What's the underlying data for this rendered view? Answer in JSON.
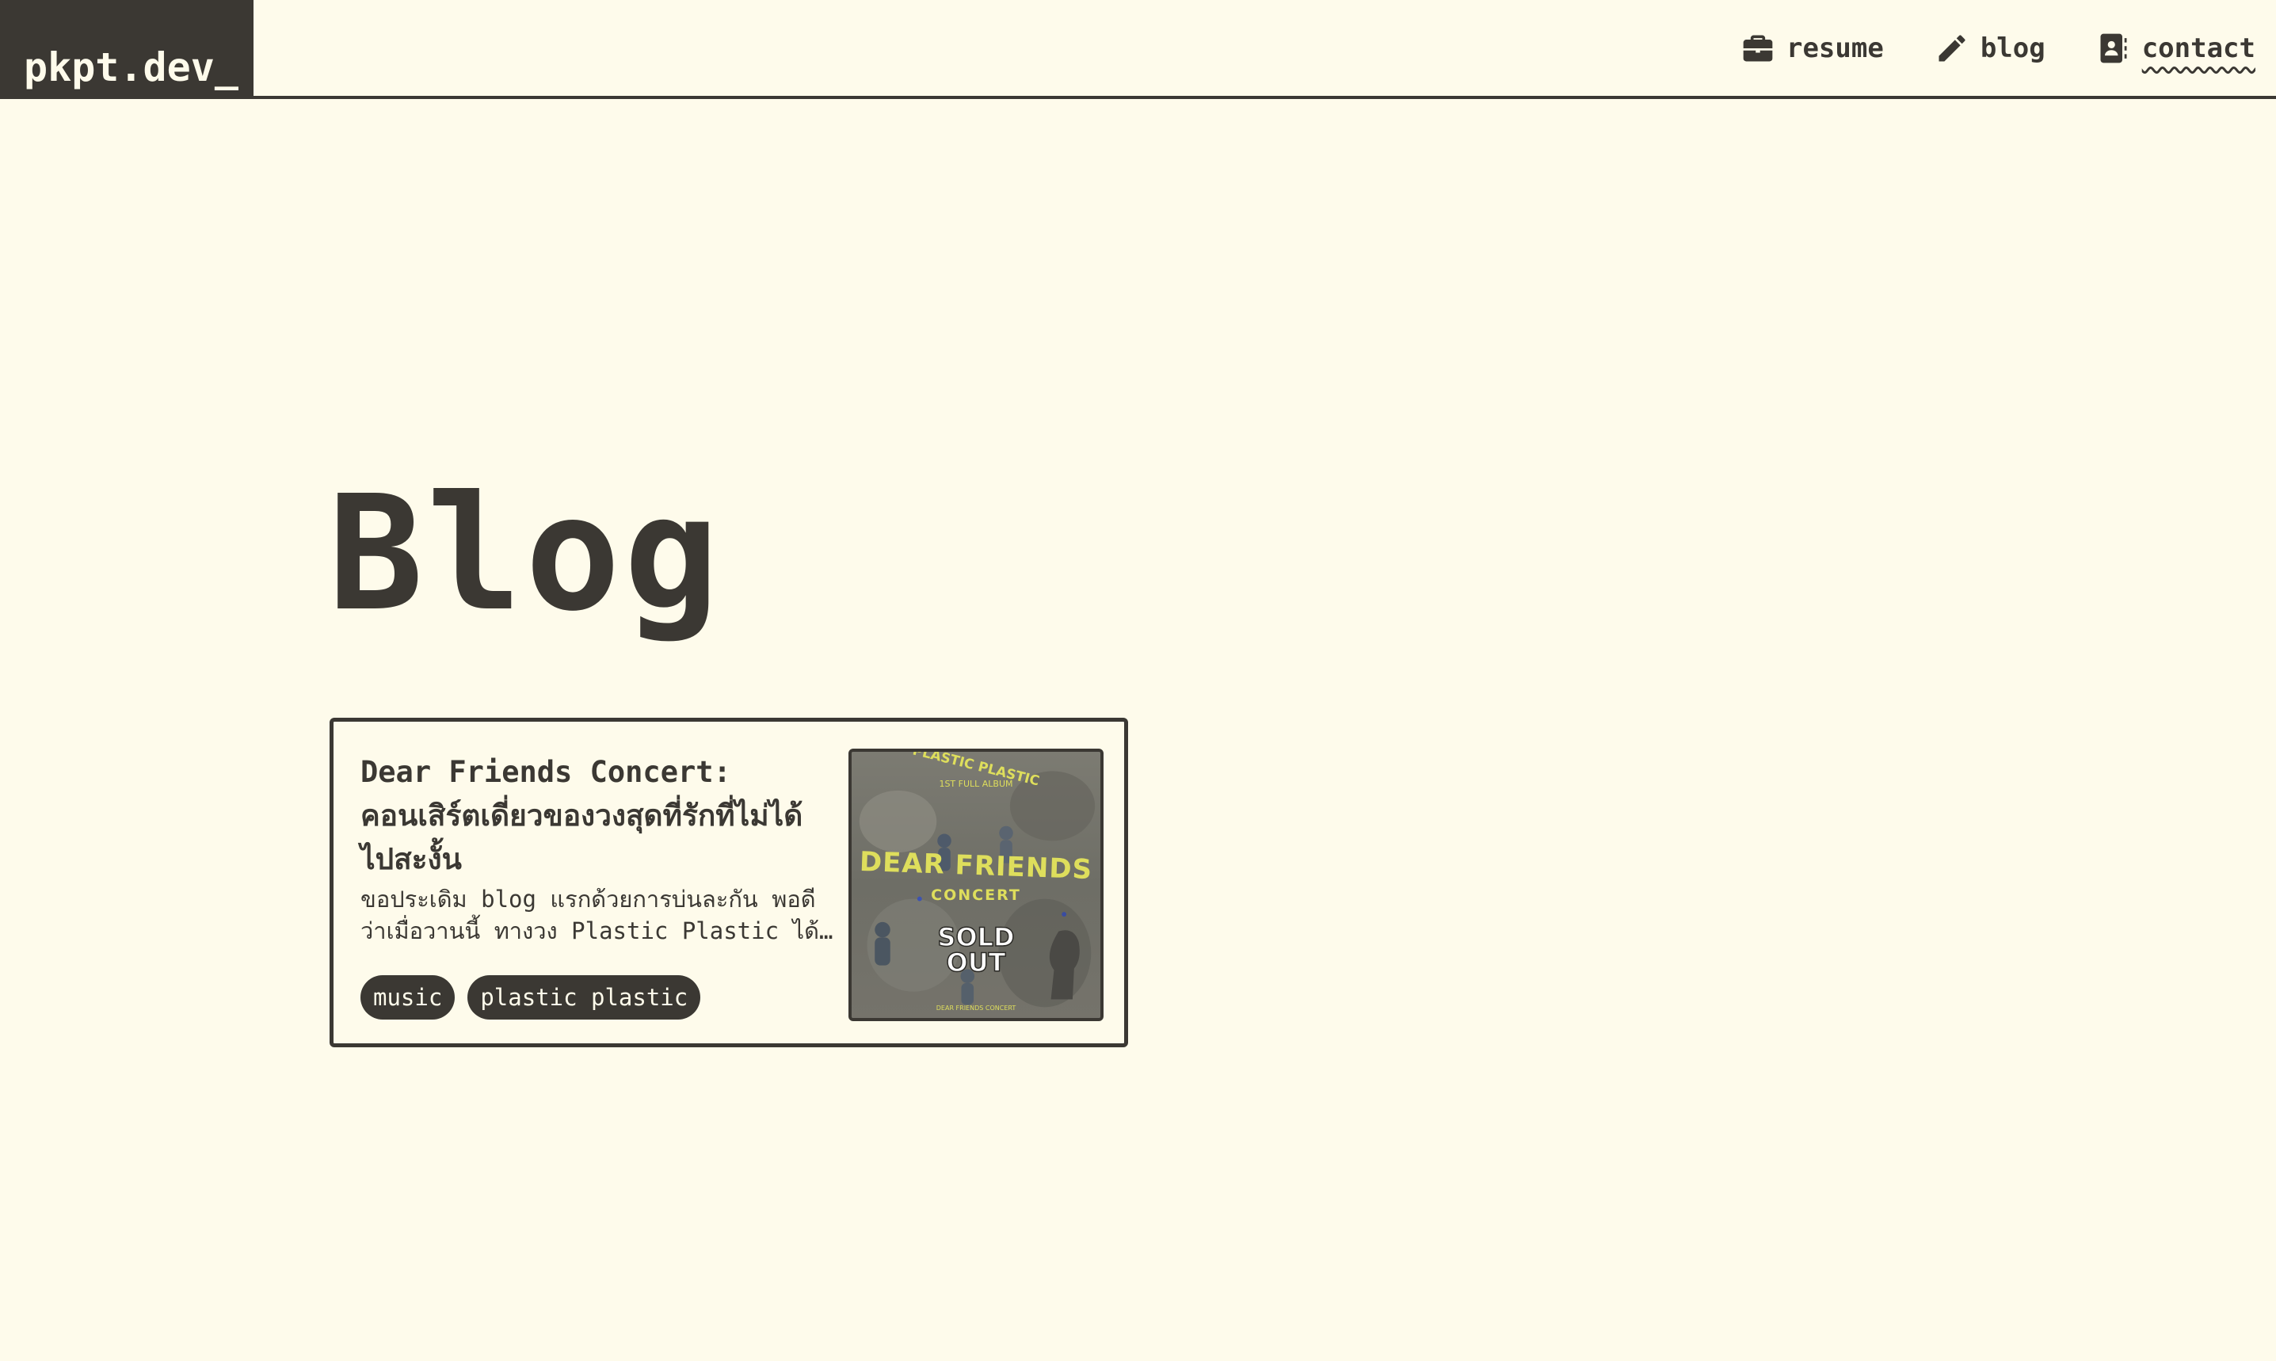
{
  "site": {
    "logo": "pkpt.dev_"
  },
  "nav": {
    "items": [
      {
        "label": "resume",
        "icon": "briefcase-icon"
      },
      {
        "label": "blog",
        "icon": "pencil-icon"
      },
      {
        "label": "contact",
        "icon": "contact-book-icon",
        "active": true
      }
    ]
  },
  "page": {
    "title": "Blog"
  },
  "posts": [
    {
      "title": "Dear Friends Concert: คอนเสิร์ตเดี่ยวของวงสุดที่รักที่ไม่ได้ไปสะงั้น",
      "excerpt": "ขอประเดิม blog แรกด้วยการบ่นละกัน พอดีว่าเมื่อวานนี้ ทางวง Plastic Plastic ได้ประกาศ",
      "tags": [
        "music",
        "plastic plastic"
      ],
      "thumbnail": {
        "arc_text": "PLASTIC PLASTIC",
        "sub_text": "1ST FULL ALBUM",
        "headline": "DEAR FRIENDS",
        "subheadline": "CONCERT",
        "stamp_line1": "SOLD",
        "stamp_line2": "OUT",
        "footer": "DEAR FRIENDS CONCERT"
      }
    }
  ],
  "colors": {
    "background": "#fefbeb",
    "ink": "#3b3833",
    "poster_accent": "#dede5c"
  }
}
